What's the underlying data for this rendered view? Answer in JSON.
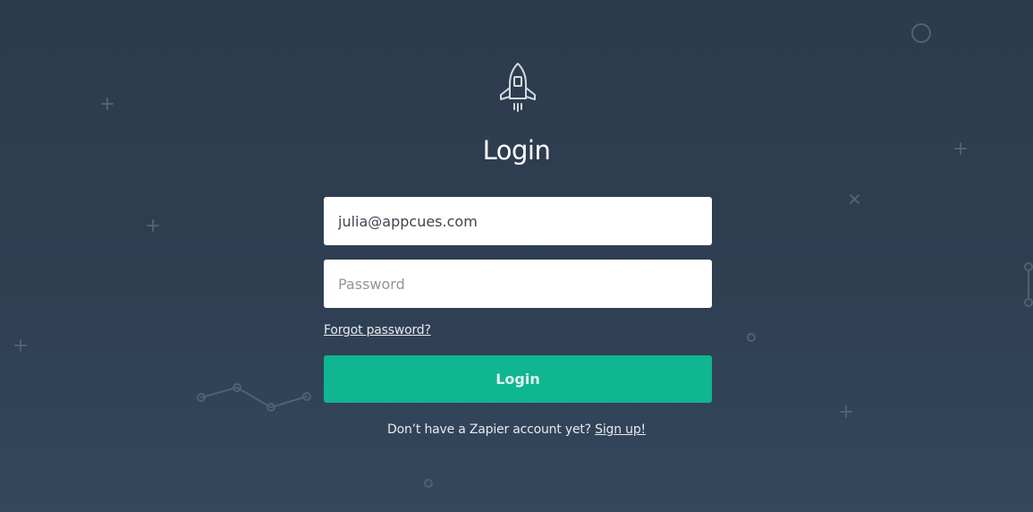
{
  "page": {
    "title": "Login"
  },
  "icons": {
    "logo": "rocket-icon"
  },
  "form": {
    "email_value": "julia@appcues.com",
    "password_placeholder": "Password",
    "forgot_label": "Forgot password?",
    "submit_label": "Login"
  },
  "signup": {
    "prompt": "Don’t have a Zapier account yet?",
    "link_label": "Sign up!"
  },
  "colors": {
    "background_top": "#2c3b4d",
    "background_bottom": "#33475d",
    "primary_button": "#10b592",
    "text_light": "#e6eaee"
  }
}
